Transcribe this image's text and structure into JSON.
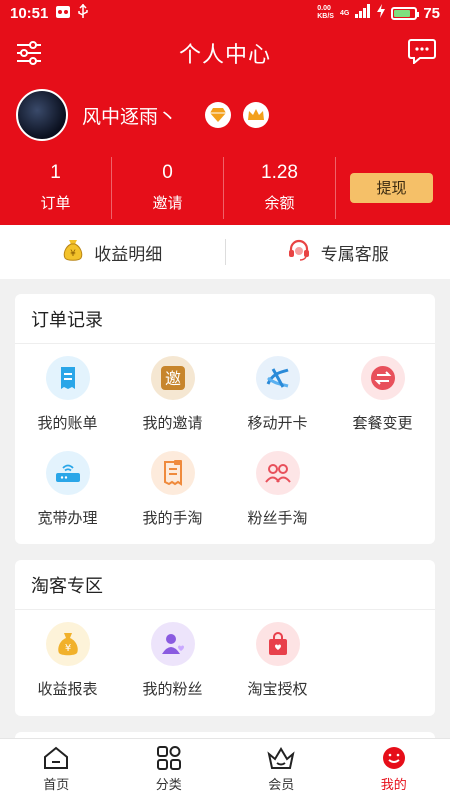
{
  "status_bar": {
    "time": "10:51",
    "net_speed": "0.00",
    "net_unit": "KB/S",
    "network": "4G",
    "battery": "75"
  },
  "header": {
    "title": "个人中心",
    "settings_icon": "sliders-icon",
    "message_icon": "chat-bubble-icon"
  },
  "profile": {
    "username": "风中逐雨丶",
    "badges": [
      {
        "icon": "diamond-badge-icon",
        "level": "0"
      },
      {
        "icon": "crown-badge-icon",
        "level": "1"
      }
    ]
  },
  "stats": [
    {
      "value": "1",
      "label": "订单"
    },
    {
      "value": "0",
      "label": "邀请"
    },
    {
      "value": "1.28",
      "label": "余额"
    }
  ],
  "withdraw_label": "提现",
  "quick_links": [
    {
      "icon": "money-bag-icon",
      "label": "收益明细"
    },
    {
      "icon": "headset-icon",
      "label": "专属客服"
    }
  ],
  "orders_section": {
    "title": "订单记录",
    "items": [
      {
        "icon": "bill-icon",
        "label": "我的账单",
        "color": "#2aa6e8",
        "bg": "#e3f3fd"
      },
      {
        "icon": "invite-icon",
        "label": "我的邀请",
        "color": "#c7852c",
        "bg": "#f5e7d2"
      },
      {
        "icon": "china-mobile-icon",
        "label": "移动开卡",
        "color": "#2a8ad8",
        "bg": "#e7f1fb"
      },
      {
        "icon": "swap-icon",
        "label": "套餐变更",
        "color": "#e8505b",
        "bg": "#fde5e6"
      },
      {
        "icon": "router-icon",
        "label": "宽带办理",
        "color": "#2aa6e8",
        "bg": "#e3f3fd"
      },
      {
        "icon": "receipt-icon",
        "label": "我的手淘",
        "color": "#ef8a3c",
        "bg": "#fdebdc"
      },
      {
        "icon": "fans-icon",
        "label": "粉丝手淘",
        "color": "#e8505b",
        "bg": "#fde5e6"
      }
    ]
  },
  "taoke_section": {
    "title": "淘客专区",
    "items": [
      {
        "icon": "yen-bag-icon",
        "label": "收益报表",
        "color": "#f1b12b",
        "bg": "#fdf3d9"
      },
      {
        "icon": "my-fans-icon",
        "label": "我的粉丝",
        "color": "#8a5be0",
        "bg": "#ede4fb"
      },
      {
        "icon": "shopping-bag-icon",
        "label": "淘宝授权",
        "color": "#e8404b",
        "bg": "#fde3e4"
      }
    ]
  },
  "nav": [
    {
      "icon": "home-icon",
      "label": "首页",
      "active": false
    },
    {
      "icon": "category-icon",
      "label": "分类",
      "active": false
    },
    {
      "icon": "crown-basket-icon",
      "label": "会员",
      "active": false
    },
    {
      "icon": "profile-icon",
      "label": "我的",
      "active": true
    }
  ],
  "colors": {
    "primary": "#e60e19",
    "withdraw_bg": "#f5c068"
  }
}
